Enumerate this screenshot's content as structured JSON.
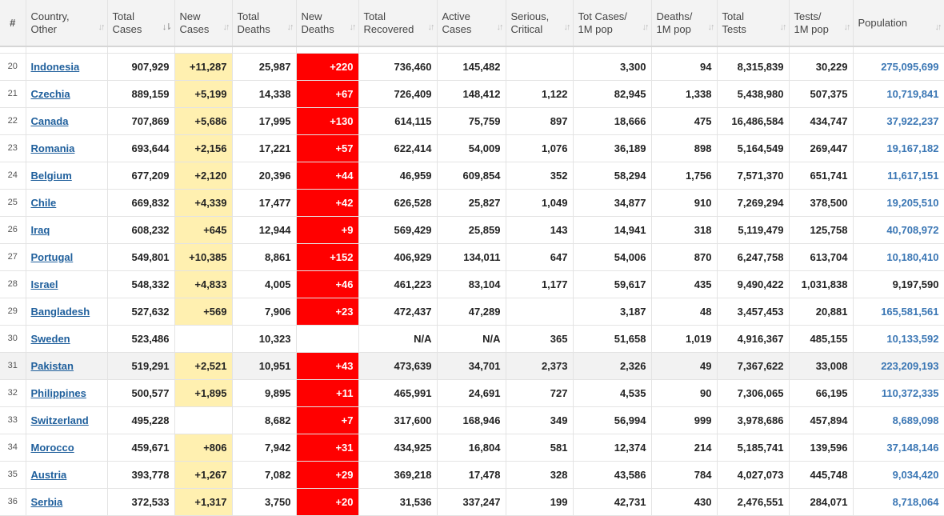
{
  "headers": {
    "num": "#",
    "country": [
      "Country,",
      "Other"
    ],
    "total_cases": [
      "Total",
      "Cases"
    ],
    "new_cases": [
      "New",
      "Cases"
    ],
    "total_deaths": [
      "Total",
      "Deaths"
    ],
    "new_deaths": [
      "New",
      "Deaths"
    ],
    "total_recovered": [
      "Total",
      "Recovered"
    ],
    "active_cases": [
      "Active",
      "Cases"
    ],
    "serious": [
      "Serious,",
      "Critical"
    ],
    "tot_cases_1m": [
      "Tot Cases/",
      "1M pop"
    ],
    "deaths_1m": [
      "Deaths/",
      "1M pop"
    ],
    "total_tests": [
      "Total",
      "Tests"
    ],
    "tests_1m": [
      "Tests/",
      "1M pop"
    ],
    "population": [
      "Population"
    ]
  },
  "icons": {
    "sort": "sort-arrows-icon",
    "sort_active": "sort-desc-icon"
  },
  "colors": {
    "new_cases_bg": "#fff0b0",
    "new_deaths_bg": "#ff0000",
    "link": "#1f5f9c",
    "population_link": "#3a76b4"
  },
  "rows": [
    {
      "num": "20",
      "country": "Indonesia",
      "total_cases": "907,929",
      "new_cases": "+11,287",
      "total_deaths": "25,987",
      "new_deaths": "+220",
      "total_recovered": "736,460",
      "active_cases": "145,482",
      "serious": "",
      "tot_cases_1m": "3,300",
      "deaths_1m": "94",
      "total_tests": "8,315,839",
      "tests_1m": "30,229",
      "population": "275,095,699"
    },
    {
      "num": "21",
      "country": "Czechia",
      "total_cases": "889,159",
      "new_cases": "+5,199",
      "total_deaths": "14,338",
      "new_deaths": "+67",
      "total_recovered": "726,409",
      "active_cases": "148,412",
      "serious": "1,122",
      "tot_cases_1m": "82,945",
      "deaths_1m": "1,338",
      "total_tests": "5,438,980",
      "tests_1m": "507,375",
      "population": "10,719,841"
    },
    {
      "num": "22",
      "country": "Canada",
      "total_cases": "707,869",
      "new_cases": "+5,686",
      "total_deaths": "17,995",
      "new_deaths": "+130",
      "total_recovered": "614,115",
      "active_cases": "75,759",
      "serious": "897",
      "tot_cases_1m": "18,666",
      "deaths_1m": "475",
      "total_tests": "16,486,584",
      "tests_1m": "434,747",
      "population": "37,922,237"
    },
    {
      "num": "23",
      "country": "Romania",
      "total_cases": "693,644",
      "new_cases": "+2,156",
      "total_deaths": "17,221",
      "new_deaths": "+57",
      "total_recovered": "622,414",
      "active_cases": "54,009",
      "serious": "1,076",
      "tot_cases_1m": "36,189",
      "deaths_1m": "898",
      "total_tests": "5,164,549",
      "tests_1m": "269,447",
      "population": "19,167,182"
    },
    {
      "num": "24",
      "country": "Belgium",
      "total_cases": "677,209",
      "new_cases": "+2,120",
      "total_deaths": "20,396",
      "new_deaths": "+44",
      "total_recovered": "46,959",
      "active_cases": "609,854",
      "serious": "352",
      "tot_cases_1m": "58,294",
      "deaths_1m": "1,756",
      "total_tests": "7,571,370",
      "tests_1m": "651,741",
      "population": "11,617,151"
    },
    {
      "num": "25",
      "country": "Chile",
      "total_cases": "669,832",
      "new_cases": "+4,339",
      "total_deaths": "17,477",
      "new_deaths": "+42",
      "total_recovered": "626,528",
      "active_cases": "25,827",
      "serious": "1,049",
      "tot_cases_1m": "34,877",
      "deaths_1m": "910",
      "total_tests": "7,269,294",
      "tests_1m": "378,500",
      "population": "19,205,510"
    },
    {
      "num": "26",
      "country": "Iraq",
      "total_cases": "608,232",
      "new_cases": "+645",
      "total_deaths": "12,944",
      "new_deaths": "+9",
      "total_recovered": "569,429",
      "active_cases": "25,859",
      "serious": "143",
      "tot_cases_1m": "14,941",
      "deaths_1m": "318",
      "total_tests": "5,119,479",
      "tests_1m": "125,758",
      "population": "40,708,972"
    },
    {
      "num": "27",
      "country": "Portugal",
      "total_cases": "549,801",
      "new_cases": "+10,385",
      "total_deaths": "8,861",
      "new_deaths": "+152",
      "total_recovered": "406,929",
      "active_cases": "134,011",
      "serious": "647",
      "tot_cases_1m": "54,006",
      "deaths_1m": "870",
      "total_tests": "6,247,758",
      "tests_1m": "613,704",
      "population": "10,180,410"
    },
    {
      "num": "28",
      "country": "Israel",
      "total_cases": "548,332",
      "new_cases": "+4,833",
      "total_deaths": "4,005",
      "new_deaths": "+46",
      "total_recovered": "461,223",
      "active_cases": "83,104",
      "serious": "1,177",
      "tot_cases_1m": "59,617",
      "deaths_1m": "435",
      "total_tests": "9,490,422",
      "tests_1m": "1,031,838",
      "population": "9,197,590",
      "pop_plain": true
    },
    {
      "num": "29",
      "country": "Bangladesh",
      "total_cases": "527,632",
      "new_cases": "+569",
      "total_deaths": "7,906",
      "new_deaths": "+23",
      "total_recovered": "472,437",
      "active_cases": "47,289",
      "serious": "",
      "tot_cases_1m": "3,187",
      "deaths_1m": "48",
      "total_tests": "3,457,453",
      "tests_1m": "20,881",
      "population": "165,581,561"
    },
    {
      "num": "30",
      "country": "Sweden",
      "total_cases": "523,486",
      "new_cases": "",
      "total_deaths": "10,323",
      "new_deaths": "",
      "total_recovered": "N/A",
      "active_cases": "N/A",
      "serious": "365",
      "tot_cases_1m": "51,658",
      "deaths_1m": "1,019",
      "total_tests": "4,916,367",
      "tests_1m": "485,155",
      "population": "10,133,592"
    },
    {
      "num": "31",
      "country": "Pakistan",
      "total_cases": "519,291",
      "new_cases": "+2,521",
      "total_deaths": "10,951",
      "new_deaths": "+43",
      "total_recovered": "473,639",
      "active_cases": "34,701",
      "serious": "2,373",
      "tot_cases_1m": "2,326",
      "deaths_1m": "49",
      "total_tests": "7,367,622",
      "tests_1m": "33,008",
      "population": "223,209,193",
      "highlight": true
    },
    {
      "num": "32",
      "country": "Philippines",
      "total_cases": "500,577",
      "new_cases": "+1,895",
      "total_deaths": "9,895",
      "new_deaths": "+11",
      "total_recovered": "465,991",
      "active_cases": "24,691",
      "serious": "727",
      "tot_cases_1m": "4,535",
      "deaths_1m": "90",
      "total_tests": "7,306,065",
      "tests_1m": "66,195",
      "population": "110,372,335"
    },
    {
      "num": "33",
      "country": "Switzerland",
      "total_cases": "495,228",
      "new_cases": "",
      "total_deaths": "8,682",
      "new_deaths": "+7",
      "total_recovered": "317,600",
      "active_cases": "168,946",
      "serious": "349",
      "tot_cases_1m": "56,994",
      "deaths_1m": "999",
      "total_tests": "3,978,686",
      "tests_1m": "457,894",
      "population": "8,689,098"
    },
    {
      "num": "34",
      "country": "Morocco",
      "total_cases": "459,671",
      "new_cases": "+806",
      "total_deaths": "7,942",
      "new_deaths": "+31",
      "total_recovered": "434,925",
      "active_cases": "16,804",
      "serious": "581",
      "tot_cases_1m": "12,374",
      "deaths_1m": "214",
      "total_tests": "5,185,741",
      "tests_1m": "139,596",
      "population": "37,148,146"
    },
    {
      "num": "35",
      "country": "Austria",
      "total_cases": "393,778",
      "new_cases": "+1,267",
      "total_deaths": "7,082",
      "new_deaths": "+29",
      "total_recovered": "369,218",
      "active_cases": "17,478",
      "serious": "328",
      "tot_cases_1m": "43,586",
      "deaths_1m": "784",
      "total_tests": "4,027,073",
      "tests_1m": "445,748",
      "population": "9,034,420"
    },
    {
      "num": "36",
      "country": "Serbia",
      "total_cases": "372,533",
      "new_cases": "+1,317",
      "total_deaths": "3,750",
      "new_deaths": "+20",
      "total_recovered": "31,536",
      "active_cases": "337,247",
      "serious": "199",
      "tot_cases_1m": "42,731",
      "deaths_1m": "430",
      "total_tests": "2,476,551",
      "tests_1m": "284,071",
      "population": "8,718,064"
    }
  ]
}
